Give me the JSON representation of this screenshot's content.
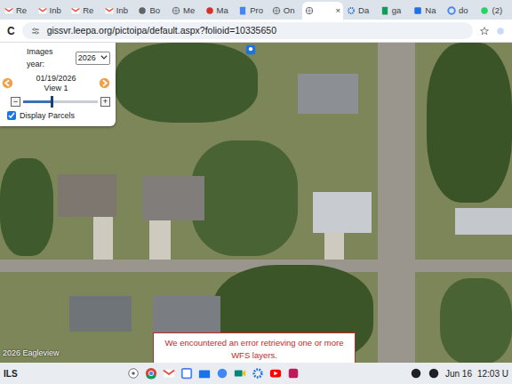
{
  "tabs": [
    {
      "label": "Re",
      "kind": "gmail",
      "selected": false
    },
    {
      "label": "Inb",
      "kind": "gmail",
      "selected": false
    },
    {
      "label": "Re",
      "kind": "gmail",
      "selected": false
    },
    {
      "label": "Inb",
      "kind": "gmail",
      "selected": false
    },
    {
      "label": "Bo",
      "kind": "circle",
      "selected": false
    },
    {
      "label": "Me",
      "kind": "globe",
      "selected": false
    },
    {
      "label": "Ma",
      "kind": "red",
      "selected": false
    },
    {
      "label": "Pro",
      "kind": "doc",
      "selected": false
    },
    {
      "label": "On",
      "kind": "globe",
      "selected": false
    },
    {
      "label": "×",
      "kind": "globe",
      "selected": true
    },
    {
      "label": "Da",
      "kind": "gear",
      "selected": false
    },
    {
      "label": "ga",
      "kind": "sheet",
      "selected": false
    },
    {
      "label": "Na",
      "kind": "blue",
      "selected": false
    },
    {
      "label": "do",
      "kind": "google",
      "selected": false
    },
    {
      "label": "(2)",
      "kind": "whatsapp",
      "selected": false
    }
  ],
  "address_bar": {
    "reload": "C",
    "url": "gissvr.leepa.org/pictoipa/default.aspx?folioid=10335650"
  },
  "panel": {
    "year_label": "Images year:",
    "year": "2026",
    "date": "01/19/2026",
    "view": "View 1",
    "slider": {
      "minus": "−",
      "plus": "+",
      "level": 0.38
    },
    "parcels": {
      "label": "Display Parcels",
      "checked": true
    }
  },
  "map": {
    "error": "We encountered an error retrieving one or more WFS layers.",
    "copyright": "2026 Eagleview"
  },
  "shelf": {
    "left": "ILS",
    "date": "Jun 16",
    "time": "12:03 U"
  }
}
